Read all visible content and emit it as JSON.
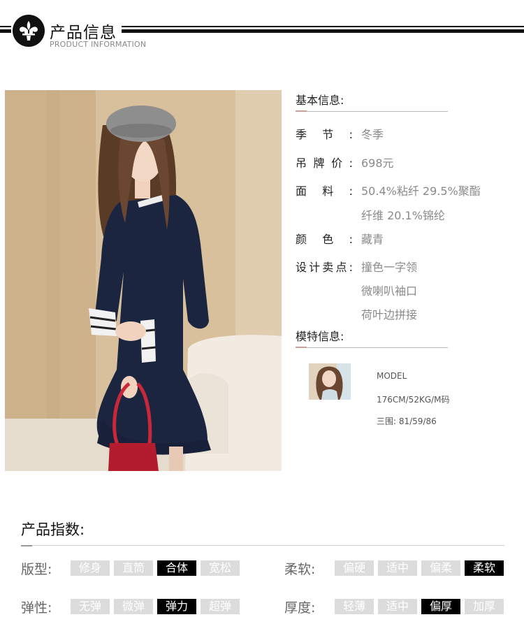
{
  "header": {
    "title": "产品信息",
    "subtitle": "PRODUCT INFORMATION",
    "logo_icon": "fleur-de-lis-icon"
  },
  "basic": {
    "title": "基本信息:",
    "rows": [
      {
        "label": "季节:",
        "value": "冬季"
      },
      {
        "label": "吊牌价:",
        "value": "698元"
      },
      {
        "label": "面料:",
        "value": "50.4%粘纤 29.5%聚酯",
        "value2": "纤维 20.1%锦纶"
      },
      {
        "label": "颜色:",
        "value": "藏青"
      },
      {
        "label": "设计卖点:",
        "value": "撞色一字领",
        "value2": "微喇叭袖口",
        "value3": "荷叶边拼接"
      }
    ]
  },
  "model": {
    "title": "模特信息:",
    "line1": "MODEL",
    "line2": "176CM/52KG/M码",
    "line3": "三围: 81/59/86"
  },
  "index": {
    "title": "产品指数:",
    "rows": [
      {
        "label": "版型:",
        "options": [
          "修身",
          "直筒",
          "合体",
          "宽松"
        ],
        "selected": 2
      },
      {
        "label": "柔软:",
        "options": [
          "偏硬",
          "适中",
          "偏柔",
          "柔软"
        ],
        "selected": 3
      },
      {
        "label": "弹性:",
        "options": [
          "无弹",
          "微弹",
          "弹力",
          "超弹"
        ],
        "selected": 2
      },
      {
        "label": "厚度:",
        "options": [
          "轻薄",
          "适中",
          "偏厚",
          "加厚"
        ],
        "selected": 2
      }
    ]
  },
  "colors": {
    "accent": "#000000",
    "chip_off": "#dcdcdc",
    "value_text": "#8a8a8a"
  }
}
